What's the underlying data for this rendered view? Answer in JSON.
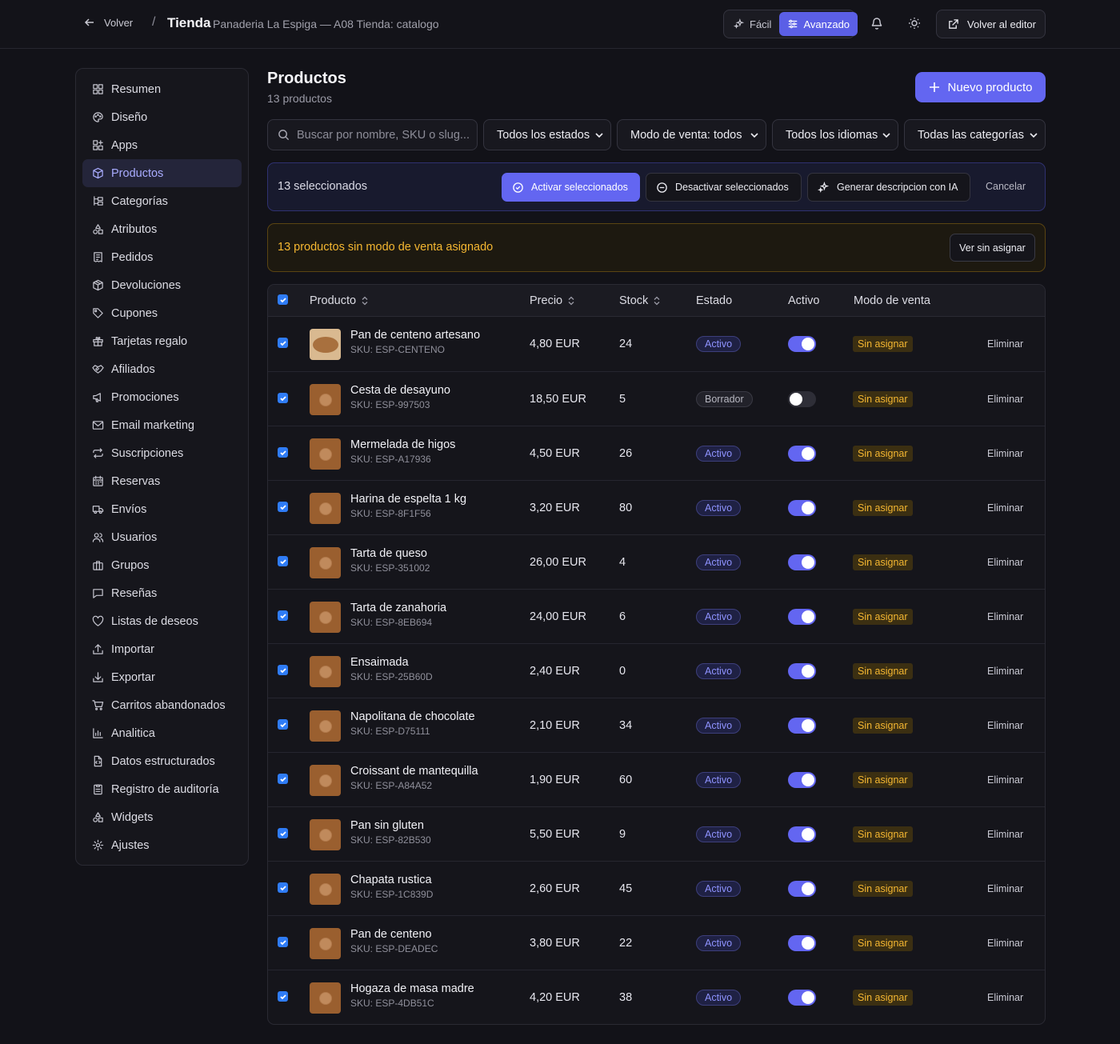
{
  "header": {
    "back_label": "Volver",
    "separator": "/",
    "title": "Tienda",
    "subtitle": "Panaderia La Espiga — A08 Tienda: catalogo",
    "mode_easy": "Fácil",
    "mode_advanced": "Avanzado",
    "editor_label": "Volver al editor"
  },
  "sidebar": {
    "items": [
      {
        "label": "Resumen",
        "icon": "grid-icon"
      },
      {
        "label": "Diseño",
        "icon": "palette-icon"
      },
      {
        "label": "Apps",
        "icon": "apps-icon"
      },
      {
        "label": "Productos",
        "icon": "box-icon",
        "active": true
      },
      {
        "label": "Categorías",
        "icon": "tree-icon"
      },
      {
        "label": "Atributos",
        "icon": "shapes-icon"
      },
      {
        "label": "Pedidos",
        "icon": "receipt-icon"
      },
      {
        "label": "Devoluciones",
        "icon": "package-return-icon"
      },
      {
        "label": "Cupones",
        "icon": "tag-icon"
      },
      {
        "label": "Tarjetas regalo",
        "icon": "gift-icon"
      },
      {
        "label": "Afiliados",
        "icon": "handshake-icon"
      },
      {
        "label": "Promociones",
        "icon": "megaphone-icon"
      },
      {
        "label": "Email marketing",
        "icon": "mail-icon"
      },
      {
        "label": "Suscripciones",
        "icon": "repeat-icon"
      },
      {
        "label": "Reservas",
        "icon": "calendar-icon"
      },
      {
        "label": "Envíos",
        "icon": "truck-icon"
      },
      {
        "label": "Usuarios",
        "icon": "users-icon"
      },
      {
        "label": "Grupos",
        "icon": "groups-icon"
      },
      {
        "label": "Reseñas",
        "icon": "message-icon"
      },
      {
        "label": "Listas de deseos",
        "icon": "heart-icon"
      },
      {
        "label": "Importar",
        "icon": "upload-icon"
      },
      {
        "label": "Exportar",
        "icon": "download-icon"
      },
      {
        "label": "Carritos abandonados",
        "icon": "cart-icon"
      },
      {
        "label": "Analitica",
        "icon": "chart-icon"
      },
      {
        "label": "Datos estructurados",
        "icon": "file-code-icon"
      },
      {
        "label": "Registro de auditoría",
        "icon": "clipboard-icon"
      },
      {
        "label": "Widgets",
        "icon": "widgets-icon"
      },
      {
        "label": "Ajustes",
        "icon": "gear-icon"
      }
    ]
  },
  "main": {
    "title": "Productos",
    "count": "13 productos",
    "new_button": "Nuevo producto",
    "search_placeholder": "Buscar por nombre, SKU o slug...",
    "filters": {
      "status": "Todos los estados",
      "sale_mode": "Modo de venta: todos",
      "language": "Todos los idiomas",
      "category": "Todas las categorías"
    },
    "bulk": {
      "count": "13 seleccionados",
      "activate": "Activar seleccionados",
      "deactivate": "Desactivar seleccionados",
      "ai": "Generar descripcion con IA",
      "cancel": "Cancelar"
    },
    "warning": {
      "text": "13 productos sin modo de venta asignado",
      "button": "Ver sin asignar"
    },
    "table": {
      "columns": {
        "product": "Producto",
        "price": "Precio",
        "stock": "Stock",
        "status": "Estado",
        "active": "Activo",
        "sale_mode": "Modo de venta"
      },
      "rows": [
        {
          "name": "Pan de centeno artesano",
          "sku": "SKU: ESP-CENTENO",
          "price": "4,80 EUR",
          "stock": "24",
          "status": "Activo",
          "active": true,
          "sale_mode": "Sin asignar",
          "action": "Eliminar",
          "thumb": "bread"
        },
        {
          "name": "Cesta de desayuno",
          "sku": "SKU: ESP-997503",
          "price": "18,50 EUR",
          "stock": "5",
          "status": "Borrador",
          "active": false,
          "sale_mode": "Sin asignar",
          "action": "Eliminar",
          "thumb": "placeholder"
        },
        {
          "name": "Mermelada de higos",
          "sku": "SKU: ESP-A17936",
          "price": "4,50 EUR",
          "stock": "26",
          "status": "Activo",
          "active": true,
          "sale_mode": "Sin asignar",
          "action": "Eliminar",
          "thumb": "placeholder"
        },
        {
          "name": "Harina de espelta 1 kg",
          "sku": "SKU: ESP-8F1F56",
          "price": "3,20 EUR",
          "stock": "80",
          "status": "Activo",
          "active": true,
          "sale_mode": "Sin asignar",
          "action": "Eliminar",
          "thumb": "placeholder"
        },
        {
          "name": "Tarta de queso",
          "sku": "SKU: ESP-351002",
          "price": "26,00 EUR",
          "stock": "4",
          "status": "Activo",
          "active": true,
          "sale_mode": "Sin asignar",
          "action": "Eliminar",
          "thumb": "placeholder"
        },
        {
          "name": "Tarta de zanahoria",
          "sku": "SKU: ESP-8EB694",
          "price": "24,00 EUR",
          "stock": "6",
          "status": "Activo",
          "active": true,
          "sale_mode": "Sin asignar",
          "action": "Eliminar",
          "thumb": "placeholder"
        },
        {
          "name": "Ensaimada",
          "sku": "SKU: ESP-25B60D",
          "price": "2,40 EUR",
          "stock": "0",
          "status": "Activo",
          "active": true,
          "sale_mode": "Sin asignar",
          "action": "Eliminar",
          "thumb": "placeholder"
        },
        {
          "name": "Napolitana de chocolate",
          "sku": "SKU: ESP-D75111",
          "price": "2,10 EUR",
          "stock": "34",
          "status": "Activo",
          "active": true,
          "sale_mode": "Sin asignar",
          "action": "Eliminar",
          "thumb": "placeholder"
        },
        {
          "name": "Croissant de mantequilla",
          "sku": "SKU: ESP-A84A52",
          "price": "1,90 EUR",
          "stock": "60",
          "status": "Activo",
          "active": true,
          "sale_mode": "Sin asignar",
          "action": "Eliminar",
          "thumb": "placeholder"
        },
        {
          "name": "Pan sin gluten",
          "sku": "SKU: ESP-82B530",
          "price": "5,50 EUR",
          "stock": "9",
          "status": "Activo",
          "active": true,
          "sale_mode": "Sin asignar",
          "action": "Eliminar",
          "thumb": "placeholder"
        },
        {
          "name": "Chapata rustica",
          "sku": "SKU: ESP-1C839D",
          "price": "2,60 EUR",
          "stock": "45",
          "status": "Activo",
          "active": true,
          "sale_mode": "Sin asignar",
          "action": "Eliminar",
          "thumb": "placeholder"
        },
        {
          "name": "Pan de centeno",
          "sku": "SKU: ESP-DEADEC",
          "price": "3,80 EUR",
          "stock": "22",
          "status": "Activo",
          "active": true,
          "sale_mode": "Sin asignar",
          "action": "Eliminar",
          "thumb": "placeholder"
        },
        {
          "name": "Hogaza de masa madre",
          "sku": "SKU: ESP-4DB51C",
          "price": "4,20 EUR",
          "stock": "38",
          "status": "Activo",
          "active": true,
          "sale_mode": "Sin asignar",
          "action": "Eliminar",
          "thumb": "placeholder"
        }
      ]
    }
  },
  "colors": {
    "accent": "#6366f1",
    "warning": "#f5b731",
    "checkbox": "#2f7cf6",
    "background": "#121218"
  }
}
